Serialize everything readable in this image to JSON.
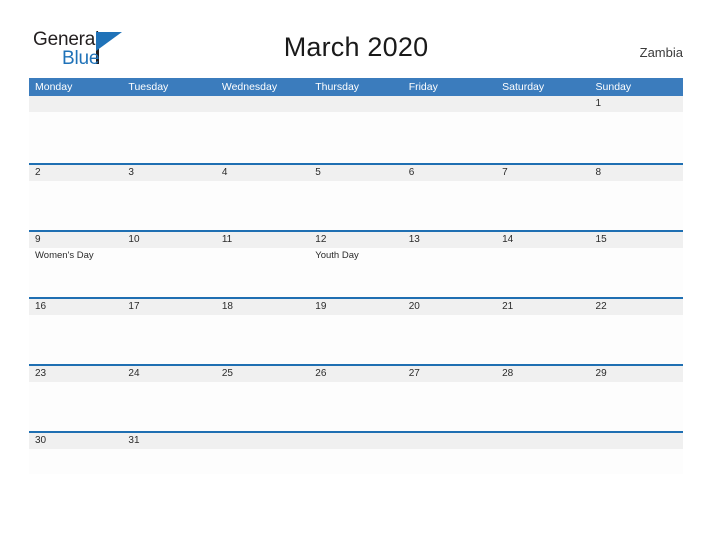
{
  "brand": {
    "logo_text_primary": "General",
    "logo_text_secondary": "Blue",
    "logo_triangle_icon": "blue-triangle-icon"
  },
  "header": {
    "title": "March 2020",
    "country": "Zambia"
  },
  "colors": {
    "header_blue": "#3b7cbd",
    "row_border_blue": "#1f6fb2",
    "day_band_gray": "#f0f0f0",
    "logo_blue": "#1f72b8",
    "text_dark": "#2b2b2b"
  },
  "calendar": {
    "weekdays": [
      "Monday",
      "Tuesday",
      "Wednesday",
      "Thursday",
      "Friday",
      "Saturday",
      "Sunday"
    ],
    "weeks": [
      [
        {
          "day": "",
          "event": ""
        },
        {
          "day": "",
          "event": ""
        },
        {
          "day": "",
          "event": ""
        },
        {
          "day": "",
          "event": ""
        },
        {
          "day": "",
          "event": ""
        },
        {
          "day": "",
          "event": ""
        },
        {
          "day": "1",
          "event": ""
        }
      ],
      [
        {
          "day": "2",
          "event": ""
        },
        {
          "day": "3",
          "event": ""
        },
        {
          "day": "4",
          "event": ""
        },
        {
          "day": "5",
          "event": ""
        },
        {
          "day": "6",
          "event": ""
        },
        {
          "day": "7",
          "event": ""
        },
        {
          "day": "8",
          "event": ""
        }
      ],
      [
        {
          "day": "9",
          "event": "Women's Day"
        },
        {
          "day": "10",
          "event": ""
        },
        {
          "day": "11",
          "event": ""
        },
        {
          "day": "12",
          "event": "Youth Day"
        },
        {
          "day": "13",
          "event": ""
        },
        {
          "day": "14",
          "event": ""
        },
        {
          "day": "15",
          "event": ""
        }
      ],
      [
        {
          "day": "16",
          "event": ""
        },
        {
          "day": "17",
          "event": ""
        },
        {
          "day": "18",
          "event": ""
        },
        {
          "day": "19",
          "event": ""
        },
        {
          "day": "20",
          "event": ""
        },
        {
          "day": "21",
          "event": ""
        },
        {
          "day": "22",
          "event": ""
        }
      ],
      [
        {
          "day": "23",
          "event": ""
        },
        {
          "day": "24",
          "event": ""
        },
        {
          "day": "25",
          "event": ""
        },
        {
          "day": "26",
          "event": ""
        },
        {
          "day": "27",
          "event": ""
        },
        {
          "day": "28",
          "event": ""
        },
        {
          "day": "29",
          "event": ""
        }
      ],
      [
        {
          "day": "30",
          "event": ""
        },
        {
          "day": "31",
          "event": ""
        },
        {
          "day": "",
          "event": ""
        },
        {
          "day": "",
          "event": ""
        },
        {
          "day": "",
          "event": ""
        },
        {
          "day": "",
          "event": ""
        },
        {
          "day": "",
          "event": ""
        }
      ]
    ]
  }
}
